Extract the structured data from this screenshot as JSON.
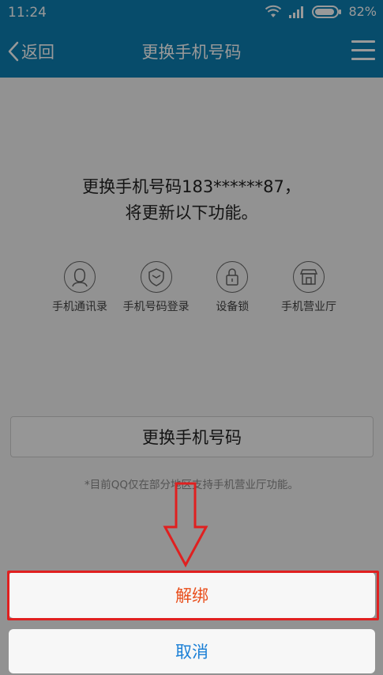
{
  "status_bar": {
    "time": "11:24",
    "battery": "82%"
  },
  "nav": {
    "back_label": "返回",
    "title": "更换手机号码"
  },
  "content": {
    "headline_line1": "更换手机号码183******87，",
    "headline_line2": "将更新以下功能。",
    "features": [
      {
        "label": "手机通讯录",
        "icon": "contacts-icon"
      },
      {
        "label": "手机号码登录",
        "icon": "shield-icon"
      },
      {
        "label": "设备锁",
        "icon": "lock-icon"
      },
      {
        "label": "手机营业厅",
        "icon": "store-icon"
      }
    ],
    "change_button": "更换手机号码",
    "note": "*目前QQ仅在部分地区支持手机营业厅功能。"
  },
  "sheet": {
    "unbind_label": "解绑",
    "cancel_label": "取消"
  },
  "colors": {
    "header_blue": "#0c7fb2",
    "unbind_orange": "#e94e1b",
    "cancel_blue": "#1a7fd6",
    "highlight_red": "#e02020"
  }
}
